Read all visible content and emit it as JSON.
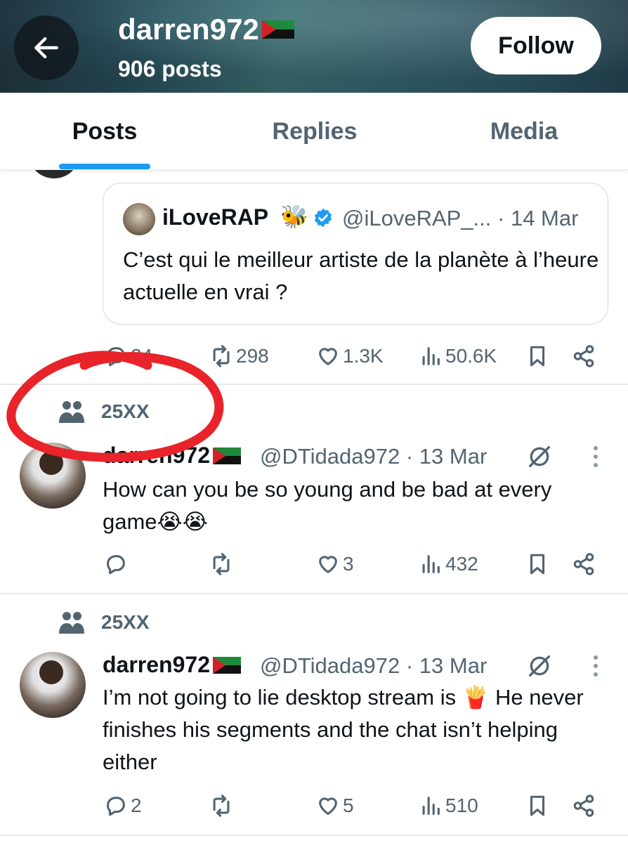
{
  "header": {
    "display_name": "darren972",
    "posts_count": "906 posts",
    "follow_label": "Follow"
  },
  "tabs": [
    {
      "label": "Posts",
      "active": true
    },
    {
      "label": "Replies",
      "active": false
    },
    {
      "label": "Media",
      "active": false
    }
  ],
  "quoted_post": {
    "name": "iLoveRAP",
    "emoji": "🐝",
    "handle": "@iLoveRAP_...",
    "date": "· 14 Mar",
    "text": "C’est qui le meilleur artiste de la planète à l’heure actuelle en vrai ?",
    "stats": {
      "replies": "24",
      "reposts": "298",
      "likes": "1.3K",
      "views": "50.6K"
    }
  },
  "posts": [
    {
      "community": "25XX",
      "name": "darren972",
      "handle": "@DTidada972",
      "date": "· 13 Mar",
      "text": "How can you be so young and be bad at every game😭😭",
      "stats": {
        "replies": "",
        "reposts": "",
        "likes": "3",
        "views": "432"
      }
    },
    {
      "community": "25XX",
      "name": "darren972",
      "handle": "@DTidada972",
      "date": "· 13 Mar",
      "text": "I’m not going to lie desktop stream is 🍟 He never finishes his segments  and the chat isn’t helping either",
      "stats": {
        "replies": "2",
        "reposts": "",
        "likes": "5",
        "views": "510"
      }
    }
  ],
  "colors": {
    "accent": "#1d9bf0",
    "text_primary": "#0f1419",
    "text_secondary": "#536471",
    "annotation": "#e8232a"
  },
  "icons": [
    "back-arrow-icon",
    "martinique-flag-icon",
    "verified-badge-icon",
    "reply-icon",
    "repost-icon",
    "like-icon",
    "views-icon",
    "bookmark-icon",
    "share-icon",
    "community-icon",
    "grok-icon",
    "more-icon"
  ]
}
